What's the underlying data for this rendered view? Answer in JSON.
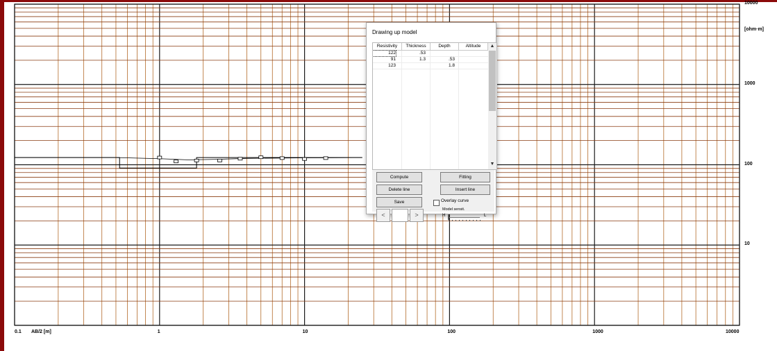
{
  "colors": {
    "window_border": "#8b0a0a",
    "major_grid": "#1a1a1a",
    "minor_grid_vertical": "#b36b2a",
    "minor_grid_horizontal": "#8a3b10",
    "curve": "#000000"
  },
  "plot": {
    "y_unit": "[ohm·m]",
    "x_axis_label": "AB/2 [m]"
  },
  "chart_data": {
    "type": "scatter",
    "x_scale": "log",
    "y_scale": "log",
    "xlim": [
      0.1,
      10000
    ],
    "ylim": [
      1,
      10000
    ],
    "xlabel": "AB/2 [m]",
    "ylabel": "[ohm·m]",
    "grid": true,
    "x_tick_labels": [
      "0.1",
      "1",
      "10",
      "100",
      "1000",
      "10000"
    ],
    "y_tick_labels": [
      "10000",
      "1000",
      "100",
      "10"
    ],
    "series": [
      {
        "kind": "measured",
        "marker": "square",
        "x": [
          1.0,
          1.3,
          1.8,
          2.6,
          3.6,
          5.0,
          7.0,
          10.0,
          14.0
        ],
        "y": [
          123,
          110,
          113,
          113,
          119,
          124,
          121,
          118,
          121
        ]
      },
      {
        "kind": "model-curve",
        "x": [
          0.1,
          0.5,
          1.0,
          1.6,
          2.5,
          4.0,
          6.0,
          10.0,
          15.0,
          25.0
        ],
        "y": [
          123,
          123,
          119,
          115,
          117,
          120,
          121,
          122,
          122.5,
          123
        ]
      },
      {
        "kind": "layered-model",
        "steps": [
          {
            "x_from": 0.1,
            "x_to": 0.53,
            "rho": 123
          },
          {
            "x_from": 0.53,
            "x_to": 1.8,
            "rho": 91
          },
          {
            "x_from": 1.8,
            "x_to": 25,
            "rho": 123
          }
        ]
      }
    ]
  },
  "dialog": {
    "title": "Drawing up model",
    "columns": [
      "Resistivity",
      "Thickness",
      "Depth",
      "Altitude"
    ],
    "rows": [
      [
        "122",
        ".53",
        "",
        ""
      ],
      [
        "91",
        "1.3",
        ".53",
        ""
      ],
      [
        "123",
        "",
        "1.8",
        ""
      ]
    ],
    "buttons": {
      "compute": "Compute",
      "fitting": "Fitting",
      "delete_line": "Delete line",
      "insert_line": "Insert line",
      "save": "Save",
      "prev": "<",
      "next": ">"
    },
    "overlay_curve_label": "Overlay curve",
    "overlay_curve_checked": false,
    "model_sensit_label": "Model sensit.",
    "slider_low": "H",
    "slider_high": "L",
    "slider_value": 0,
    "scroll_up_icon": "chevron-up-icon",
    "scroll_down_icon": "chevron-down-icon"
  }
}
